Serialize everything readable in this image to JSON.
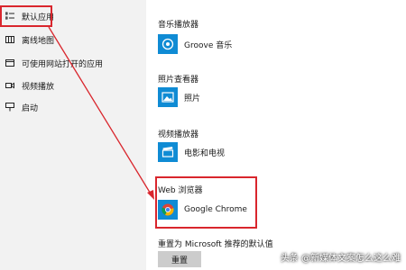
{
  "sidebar": {
    "items": [
      {
        "label": "默认应用",
        "icon": "default-apps-icon"
      },
      {
        "label": "离线地图",
        "icon": "offline-maps-icon"
      },
      {
        "label": "可使用网站打开的应用",
        "icon": "apps-for-websites-icon"
      },
      {
        "label": "视频播放",
        "icon": "video-playback-icon"
      },
      {
        "label": "启动",
        "icon": "startup-icon"
      }
    ]
  },
  "main": {
    "music": {
      "label": "音乐播放器",
      "app_name": "Groove 音乐",
      "icon": "groove-music-icon"
    },
    "photos": {
      "label": "照片查看器",
      "app_name": "照片",
      "icon": "photos-icon"
    },
    "video": {
      "label": "视频播放器",
      "app_name": "电影和电视",
      "icon": "movies-tv-icon"
    },
    "web": {
      "label": "Web 浏览器",
      "app_name": "Google Chrome",
      "icon": "chrome-icon"
    },
    "reset": {
      "label": "重置为 Microsoft 推荐的默认值",
      "button": "重置"
    }
  },
  "colors": {
    "accent": "#0f8bd4",
    "highlight": "#d9262d",
    "sidebar_bg": "#f2f2f2"
  },
  "watermark": "头条 @新媒体文案怎么这么难"
}
